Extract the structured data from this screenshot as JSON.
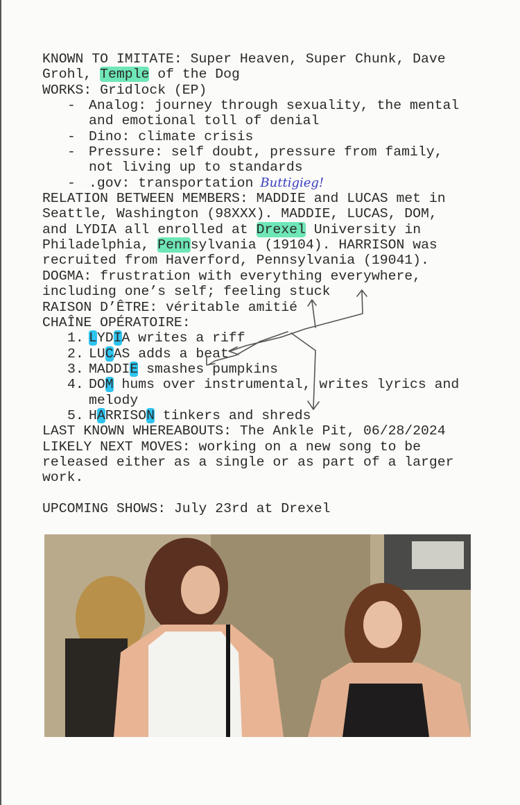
{
  "document": {
    "highlight_colors": {
      "green": "#6ee7b7",
      "blue": "#2ec4f0"
    },
    "handwriting_color": "#3a3fc0",
    "lines": [
      {
        "kind": "plain",
        "segments": [
          {
            "t": "KNOWN TO IMITATE: Super Heaven, Super Chunk, Dave"
          }
        ]
      },
      {
        "kind": "plain",
        "segments": [
          {
            "t": "Grohl, "
          },
          {
            "t": "Temple",
            "hl": "green"
          },
          {
            "t": " of the Dog"
          }
        ]
      },
      {
        "kind": "plain",
        "segments": [
          {
            "t": "WORKS: Gridlock (EP)"
          }
        ]
      },
      {
        "kind": "bullet",
        "marker": "-",
        "segments": [
          {
            "t": "Analog: journey through sexuality, the mental"
          }
        ]
      },
      {
        "kind": "cont",
        "segments": [
          {
            "t": "and emotional toll of denial"
          }
        ]
      },
      {
        "kind": "bullet",
        "marker": "-",
        "segments": [
          {
            "t": "Dino: climate crisis"
          }
        ]
      },
      {
        "kind": "bullet",
        "marker": "-",
        "segments": [
          {
            "t": "Pressure: self doubt, pressure from family,"
          }
        ]
      },
      {
        "kind": "cont",
        "segments": [
          {
            "t": "not living up to standards"
          }
        ]
      },
      {
        "kind": "bullet",
        "marker": "-",
        "segments": [
          {
            "t": ".gov: transportation"
          }
        ],
        "handwritten": "Buttigieg!"
      },
      {
        "kind": "plain",
        "segments": [
          {
            "t": "RELATION BETWEEN MEMBERS: MADDIE and LUCAS met in"
          }
        ]
      },
      {
        "kind": "plain",
        "segments": [
          {
            "t": "Seattle, Washington (98XXX). MADDIE, LUCAS, DOM,"
          }
        ]
      },
      {
        "kind": "plain",
        "segments": [
          {
            "t": "and LYDIA all enrolled at "
          },
          {
            "t": "Drexel",
            "hl": "green"
          },
          {
            "t": " University in"
          }
        ]
      },
      {
        "kind": "plain",
        "segments": [
          {
            "t": "Philadelphia, "
          },
          {
            "t": "Penn",
            "hl": "green"
          },
          {
            "t": "sylvania (19104). HARRISON was"
          }
        ]
      },
      {
        "kind": "plain",
        "segments": [
          {
            "t": "recruited from Haverford, Pennsylvania (19041)."
          }
        ]
      },
      {
        "kind": "plain",
        "segments": [
          {
            "t": "DOGMA: frustration with everything everywhere,"
          }
        ]
      },
      {
        "kind": "plain",
        "segments": [
          {
            "t": "including one’s self; feeling stuck"
          }
        ]
      },
      {
        "kind": "plain",
        "segments": [
          {
            "t": "RAISON D’ÊTRE: véritable amitié"
          }
        ]
      },
      {
        "kind": "plain",
        "segments": [
          {
            "t": "CHAÎNE OPÉRATOIRE:"
          }
        ]
      },
      {
        "kind": "num",
        "marker": "1.",
        "segments": [
          {
            "t": "L",
            "hl": "blue"
          },
          {
            "t": "YD"
          },
          {
            "t": "I",
            "hl": "blue"
          },
          {
            "t": "A writes a riff"
          }
        ]
      },
      {
        "kind": "num",
        "marker": "2.",
        "segments": [
          {
            "t": "LU"
          },
          {
            "t": "C",
            "hl": "blue"
          },
          {
            "t": "AS adds a beat"
          }
        ]
      },
      {
        "kind": "num",
        "marker": "3.",
        "segments": [
          {
            "t": "MADDI"
          },
          {
            "t": "E",
            "hl": "blue"
          },
          {
            "t": " smashes pumpkins"
          }
        ]
      },
      {
        "kind": "num",
        "marker": "4.",
        "segments": [
          {
            "t": "DO"
          },
          {
            "t": "M",
            "hl": "blue"
          },
          {
            "t": " hums over instrumental, writes lyrics and"
          }
        ]
      },
      {
        "kind": "cont",
        "segments": [
          {
            "t": "melody"
          }
        ]
      },
      {
        "kind": "num",
        "marker": "5.",
        "segments": [
          {
            "t": "H"
          },
          {
            "t": "A",
            "hl": "blue"
          },
          {
            "t": "RRISO"
          },
          {
            "t": "N",
            "hl": "blue"
          },
          {
            "t": " tinkers and shreds"
          }
        ]
      },
      {
        "kind": "plain",
        "segments": [
          {
            "t": "LAST KNOWN WHEREABOUTS: The Ankle Pit, 06/28/2024"
          }
        ]
      },
      {
        "kind": "plain",
        "segments": [
          {
            "t": "LIKELY NEXT MOVES: working on a new song to be"
          }
        ]
      },
      {
        "kind": "plain",
        "segments": [
          {
            "t": "released either as a single or as part of a larger"
          }
        ]
      },
      {
        "kind": "plain",
        "segments": [
          {
            "t": "work."
          }
        ]
      },
      {
        "kind": "plain",
        "segments": [
          {
            "t": ""
          }
        ]
      },
      {
        "kind": "plain",
        "segments": [
          {
            "t": "UPCOMING SHOWS: July 23rd at Drexel"
          }
        ]
      }
    ]
  },
  "photo": {
    "subject": "band members performing"
  }
}
